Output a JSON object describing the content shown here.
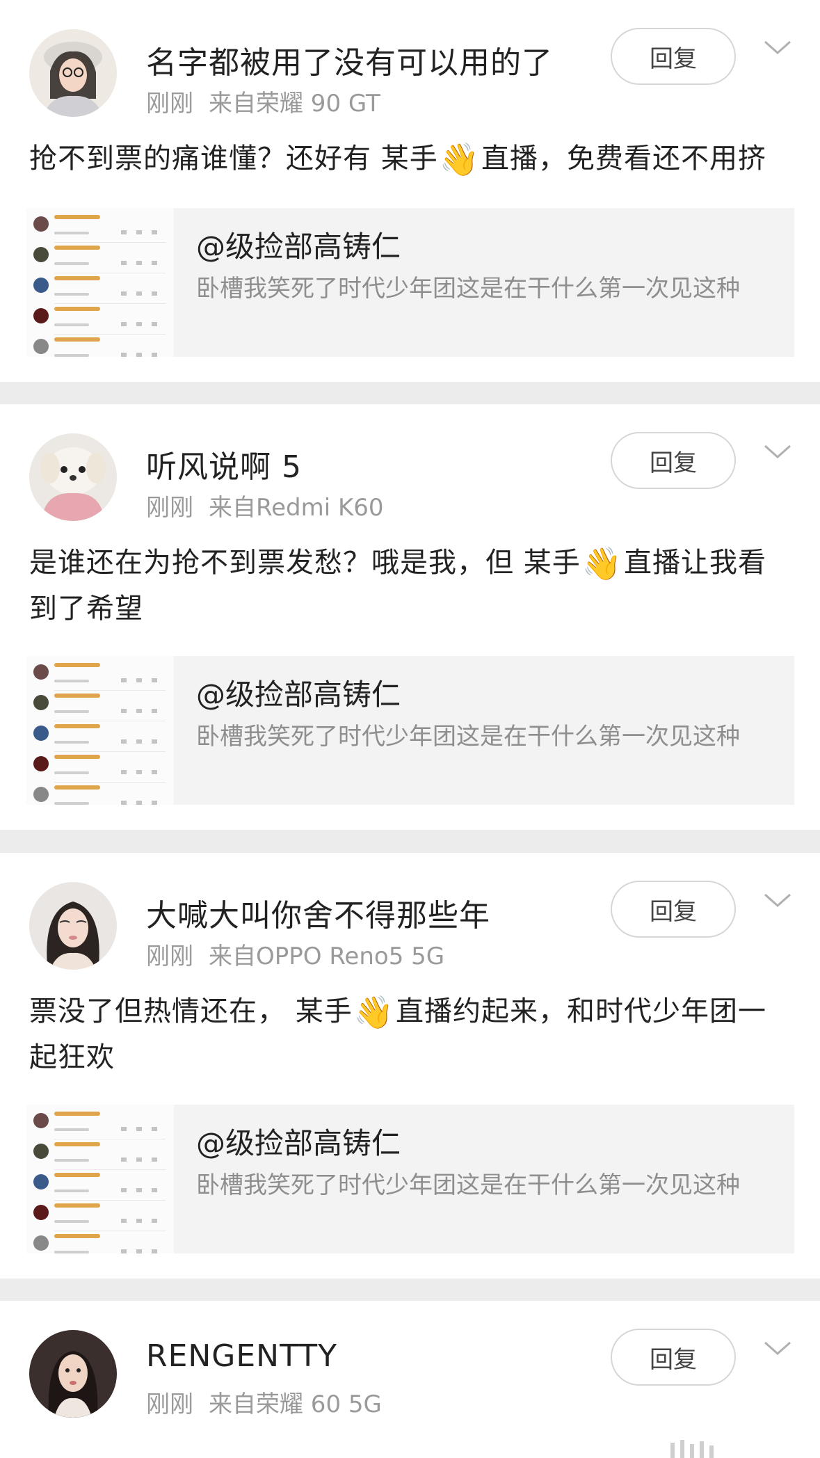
{
  "comments": [
    {
      "username": "名字都被用了没有可以用的了",
      "time": "刚刚",
      "source": "来自荣耀 90 GT",
      "reply_label": "回复",
      "text_before": "抢不到票的痛谁懂？还好有 某手",
      "emoji": "👋",
      "text_after": "直播，免费看还不用挤",
      "quote_title": "@级捡部高铸仁",
      "quote_text": "卧槽我笑死了时代少年团这是在干什么第一次见这种"
    },
    {
      "username": "听风说啊 5",
      "time": "刚刚",
      "source": "来自Redmi K60",
      "reply_label": "回复",
      "text_before": "是谁还在为抢不到票发愁？哦是我，但 某手",
      "emoji": "👋",
      "text_after": "直播让我看到了希望",
      "quote_title": "@级捡部高铸仁",
      "quote_text": "卧槽我笑死了时代少年团这是在干什么第一次见这种"
    },
    {
      "username": "大喊大叫你舍不得那些年",
      "time": "刚刚",
      "source": "来自OPPO Reno5 5G",
      "reply_label": "回复",
      "text_before": "票没了但热情还在， 某手",
      "emoji": "👋",
      "text_after": "直播约起来，和时代少年团一起狂欢",
      "quote_title": "@级捡部高铸仁",
      "quote_text": "卧槽我笑死了时代少年团这是在干什么第一次见这种"
    },
    {
      "username": "RENGENTTY",
      "time": "刚刚",
      "source": "来自荣耀 60 5G",
      "reply_label": "回复"
    }
  ],
  "icons": {
    "expand": "chevron-down-icon",
    "emoji": "waving-hand-icon"
  }
}
